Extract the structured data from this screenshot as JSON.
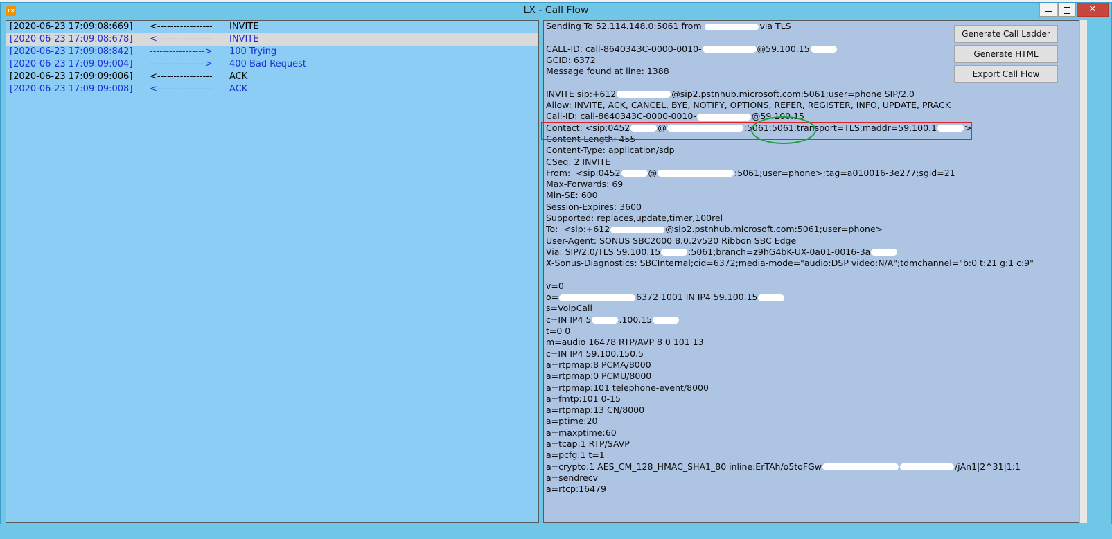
{
  "window": {
    "title": "LX - Call Flow",
    "icon_label": "LX",
    "controls": {
      "minimize": "",
      "maximize": "",
      "close": "✕"
    }
  },
  "flow": [
    {
      "timestamp": "[2020-06-23 17:09:08:669]",
      "arrow": "<-----------------",
      "message": "INVITE",
      "color": "black"
    },
    {
      "timestamp": "[2020-06-23 17:09:08:678]",
      "arrow": "<-----------------",
      "message": "INVITE",
      "color": "blue",
      "selected": true
    },
    {
      "timestamp": "[2020-06-23 17:09:08:842]",
      "arrow": "----------------->",
      "message": "100 Trying",
      "color": "blue"
    },
    {
      "timestamp": "[2020-06-23 17:09:09:004]",
      "arrow": "----------------->",
      "message": "400 Bad Request",
      "color": "blue"
    },
    {
      "timestamp": "[2020-06-23 17:09:09:006]",
      "arrow": "<-----------------",
      "message": "ACK",
      "color": "black"
    },
    {
      "timestamp": "[2020-06-23 17:09:09:008]",
      "arrow": "<-----------------",
      "message": "ACK",
      "color": "blue"
    }
  ],
  "buttons": {
    "generate_ladder": "Generate Call Ladder",
    "generate_html": "Generate HTML",
    "export_flow": "Export Call Flow"
  },
  "sip": {
    "sending": "Sending To 52.114.148.0:5061 from",
    "sending_tail": "via TLS",
    "call_id_a": "CALL-ID: call-8640343C-0000-0010-",
    "call_id_b": "@59.100.15",
    "gcid": "GCID: 6372",
    "found": "Message found at line: 1388",
    "invite_a": "INVITE sip:+612",
    "invite_b": "@sip2.pstnhub.microsoft.com:5061;user=phone SIP/2.0",
    "allow": "Allow: INVITE, ACK, CANCEL, BYE, NOTIFY, OPTIONS, REFER, REGISTER, INFO, UPDATE, PRACK",
    "callid2_a": "Call-ID: call-8640343C-0000-0010-",
    "callid2_b": "@59.100.15",
    "contact_a": "Contact: <sip:0452",
    "contact_b": "@",
    "contact_c": ":5061:5061;transport=TLS;maddr=59.100.1",
    "contact_d": ">",
    "content_length": "Content-Length: 455",
    "content_type": "Content-Type: application/sdp",
    "cseq": "CSeq: 2 INVITE",
    "from_a": "From:  <sip:0452",
    "from_b": "@",
    "from_c": ":5061;user=phone>;tag=a010016-3e277;sgid=21",
    "max_forwards": "Max-Forwards: 69",
    "min_se": "Min-SE: 600",
    "session_expires": "Session-Expires: 3600",
    "supported": "Supported: replaces,update,timer,100rel",
    "to_a": "To:  <sip:+612",
    "to_b": "@sip2.pstnhub.microsoft.com:5061;user=phone>",
    "user_agent": "User-Agent: SONUS SBC2000 8.0.2v520 Ribbon SBC Edge",
    "via_a": "Via: SIP/2.0/TLS 59.100.15",
    "via_b": ":5061;branch=z9hG4bK-UX-0a01-0016-3a",
    "diag": "X-Sonus-Diagnostics: SBCInternal;cid=6372;media-mode=\"audio:DSP video:N/A\";tdmchannel=\"b:0 t:21 g:1 c:9\"",
    "v": "v=0",
    "o_a": "o=",
    "o_b": "6372 1001 IN IP4 59.100.15",
    "s": "s=VoipCall",
    "c1_a": "c=IN IP4 5",
    "c1_b": ".100.15",
    "t": "t=0 0",
    "m": "m=audio 16478 RTP/AVP 8 0 101 13",
    "c2": "c=IN IP4 59.100.150.5",
    "rtpmap8": "a=rtpmap:8 PCMA/8000",
    "rtpmap0": "a=rtpmap:0 PCMU/8000",
    "rtpmap101": "a=rtpmap:101 telephone-event/8000",
    "fmtp": "a=fmtp:101 0-15",
    "rtpmap13": "a=rtpmap:13 CN/8000",
    "ptime": "a=ptime:20",
    "maxptime": "a=maxptime:60",
    "tcap": "a=tcap:1 RTP/SAVP",
    "pcfg": "a=pcfg:1 t=1",
    "crypto_a": "a=crypto:1 AES_CM_128_HMAC_SHA1_80 inline:ErTAh/o5toFGw",
    "crypto_b": "/jAn1|2^31|1:1",
    "sendrecv": "a=sendrecv",
    "rtcp": "a=rtcp:16479"
  },
  "colors": {
    "left_bg": "#8bcdf4",
    "right_bg": "#aec4e3",
    "highlight_box": "#e0202d",
    "ellipse": "#19a33a",
    "selected_row": "#d9d9d9",
    "blue_text": "#1c30d6"
  }
}
